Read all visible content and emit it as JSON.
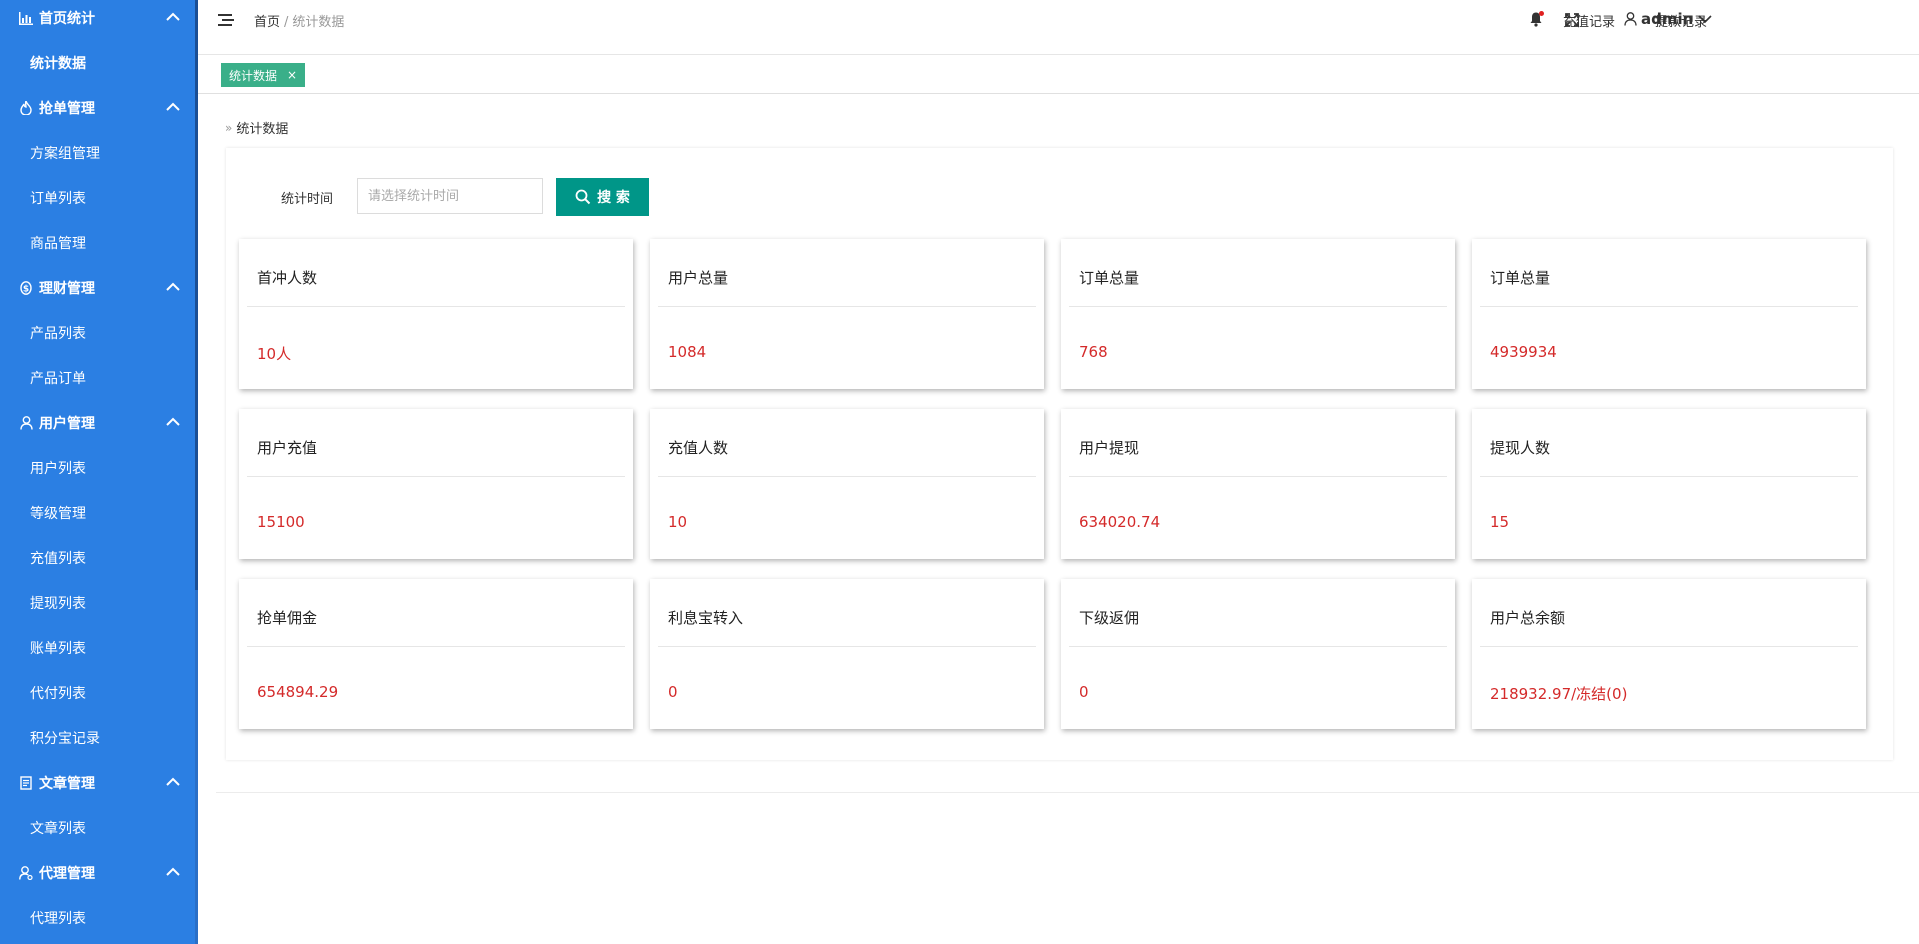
{
  "sidebar": {
    "groups": [
      {
        "label": "首页统计",
        "icon": "bar-chart-icon",
        "items": [
          "统计数据"
        ]
      },
      {
        "label": "抢单管理",
        "icon": "fire-icon",
        "items": [
          "方案组管理",
          "订单列表",
          "商品管理"
        ]
      },
      {
        "label": "理财管理",
        "icon": "coin-icon",
        "items": [
          "产品列表",
          "产品订单"
        ]
      },
      {
        "label": "用户管理",
        "icon": "user-icon",
        "items": [
          "用户列表",
          "等级管理",
          "充值列表",
          "提现列表",
          "账单列表",
          "代付列表",
          "积分宝记录"
        ]
      },
      {
        "label": "文章管理",
        "icon": "document-icon",
        "items": [
          "文章列表"
        ]
      },
      {
        "label": "代理管理",
        "icon": "agent-icon",
        "items": [
          "代理列表"
        ]
      }
    ],
    "active_item": "统计数据"
  },
  "header": {
    "breadcrumb_home": "首页",
    "breadcrumb_sep": "/",
    "breadcrumb_current": "统计数据",
    "recharge_link": "充值记录",
    "withdraw_link": "提款记录",
    "user_name": "admin"
  },
  "tabs": [
    {
      "label": "统计数据",
      "close": "×"
    }
  ],
  "content": {
    "section_title": "统计数据",
    "filter_label": "统计时间",
    "filter_placeholder": "请选择统计时间",
    "search_label": "搜 索"
  },
  "stats": [
    {
      "title": "首冲人数",
      "value": "10人"
    },
    {
      "title": "用户总量",
      "value": "1084"
    },
    {
      "title": "订单总量",
      "value": "768"
    },
    {
      "title": "订单总量",
      "value": "4939934"
    },
    {
      "title": "用户充值",
      "value": "15100"
    },
    {
      "title": "充值人数",
      "value": "10"
    },
    {
      "title": "用户提现",
      "value": "634020.74"
    },
    {
      "title": "提现人数",
      "value": "15"
    },
    {
      "title": "抢单佣金",
      "value": "654894.29"
    },
    {
      "title": "利息宝转入",
      "value": "0"
    },
    {
      "title": "下级返佣",
      "value": "0"
    },
    {
      "title": "用户总余额",
      "value": "218932.97/冻结(0)"
    }
  ],
  "colors": {
    "sidebar_bg": "#2b7fe3",
    "tab_active": "#3aaf89",
    "search_button": "#009688",
    "stat_value": "#d42a2a",
    "notification_dot": "#e02020"
  }
}
